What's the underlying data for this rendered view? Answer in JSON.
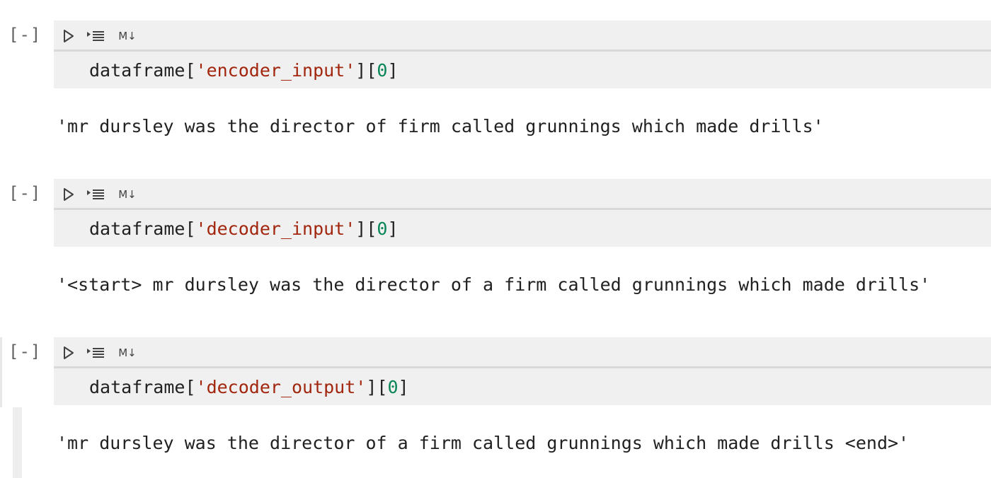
{
  "cells": [
    {
      "exec_count": "[-]",
      "toolbar": {
        "md_label": "M↓"
      },
      "code": {
        "prefix": "dataframe[",
        "string": "'encoder_input'",
        "mid": "][",
        "number": "0",
        "suffix": "]"
      },
      "output": "'mr dursley was the director of firm called grunnings which made drills'"
    },
    {
      "exec_count": "[-]",
      "toolbar": {
        "md_label": "M↓"
      },
      "code": {
        "prefix": "dataframe[",
        "string": "'decoder_input'",
        "mid": "][",
        "number": "0",
        "suffix": "]"
      },
      "output": "'<start> mr dursley was the director of a firm called grunnings which made drills'"
    },
    {
      "exec_count": "[-]",
      "toolbar": {
        "md_label": "M↓"
      },
      "code": {
        "prefix": "dataframe[",
        "string": "'decoder_output'",
        "mid": "][",
        "number": "0",
        "suffix": "]"
      },
      "output": "'mr dursley was the director of a firm called grunnings which made drills <end>'"
    }
  ],
  "icons": {
    "run": "run-cell-icon",
    "run_below": "execute-above-below-icon"
  },
  "colors": {
    "string": "#a1260d",
    "number": "#098658",
    "cell_background": "#f0f0f0"
  }
}
